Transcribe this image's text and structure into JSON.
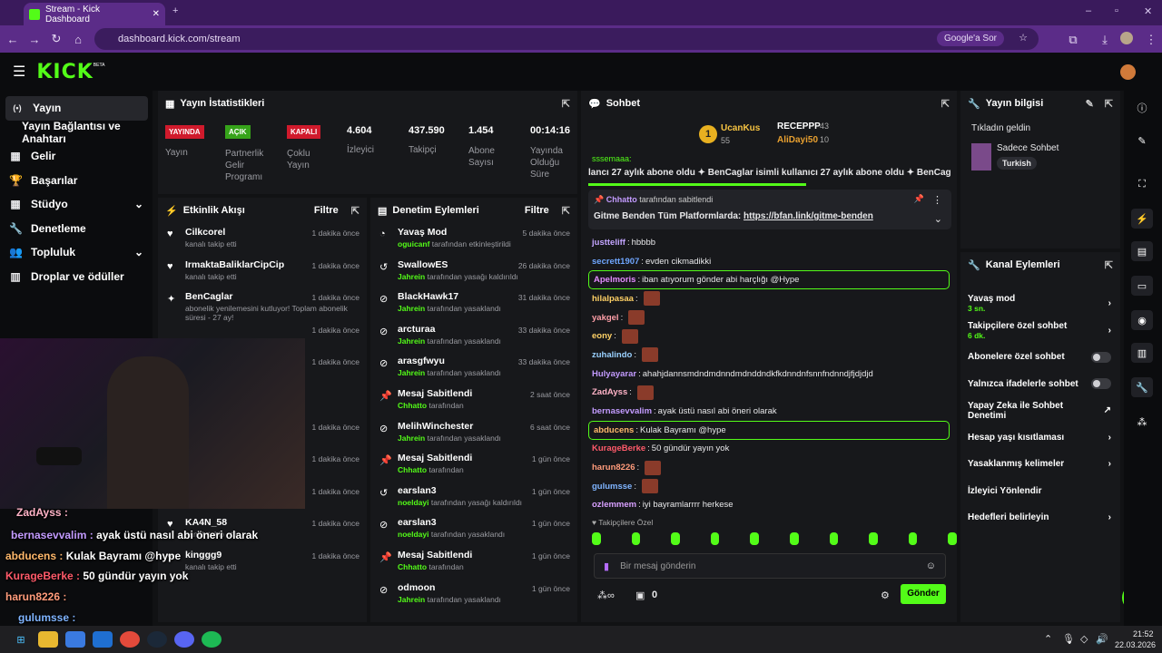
{
  "browser": {
    "tab_title": "Stream - Kick Dashboard",
    "url": "dashboard.kick.com/stream",
    "google_btn": "Google'a Sor"
  },
  "app": {
    "logo": "KICK",
    "beta": "BETA"
  },
  "nav": [
    {
      "label": "Yayın",
      "icon": "(•)"
    },
    {
      "label": "Yayın Bağlantısı ve Anahtarı",
      "icon": ""
    },
    {
      "label": "Gelir",
      "icon": "▦"
    },
    {
      "label": "Başarılar",
      "icon": "🏆"
    },
    {
      "label": "Stüdyo",
      "icon": "▦",
      "chevron": "⌄"
    },
    {
      "label": "Denetleme",
      "icon": "🔧"
    },
    {
      "label": "Topluluk",
      "icon": "👥",
      "chevron": "⌄"
    },
    {
      "label": "Droplar ve ödüller",
      "icon": "▥"
    }
  ],
  "stats": {
    "title": "Yayın İstatistikleri",
    "items": [
      {
        "value": "YAYINDA",
        "label": "Yayın",
        "badge": "red"
      },
      {
        "value": "AÇIK",
        "label": "Partnerlik Gelir Programı",
        "badge": "green"
      },
      {
        "value": "KAPALI",
        "label": "Çoklu Yayın",
        "badge": "red"
      },
      {
        "value": "4.604",
        "label": "İzleyici"
      },
      {
        "value": "437.590",
        "label": "Takipçi"
      },
      {
        "value": "1.454",
        "label": "Abone Sayısı"
      },
      {
        "value": "00:14:16",
        "label": "Yayında Olduğu Süre"
      }
    ]
  },
  "activity": {
    "title": "Etkinlik Akışı",
    "filter": "Filtre",
    "rows": [
      {
        "name": "Cilkcorel",
        "sub": "kanalı takip etti",
        "time": "1 dakika önce",
        "icon": "♥"
      },
      {
        "name": "IrmaktaBaliklarCipCip",
        "sub": "kanalı takip etti",
        "time": "1 dakika önce",
        "icon": "♥"
      },
      {
        "name": "BenCaglar",
        "sub": "abonelik yenilemesini kutluyor! Toplam abonelik süresi - 27 ay!",
        "time": "1 dakika önce",
        "icon": "✦"
      },
      {
        "name": "",
        "sub": "",
        "time": "1 dakika önce",
        "icon": ""
      },
      {
        "name": "",
        "sub": "lam abonelik",
        "time": "1 dakika önce",
        "icon": ""
      },
      {
        "name": "",
        "sub": "",
        "time": "",
        "icon": ""
      },
      {
        "name": "",
        "sub": "",
        "time": "1 dakika önce",
        "icon": ""
      },
      {
        "name": "",
        "sub": "",
        "time": "1 dakika önce",
        "icon": ""
      },
      {
        "name": "kinggg9",
        "sub": "",
        "time": "1 dakika önce",
        "icon": "♥"
      },
      {
        "name": "KA4N_58",
        "sub": "kanalı takip etti",
        "time": "1 dakika önce",
        "icon": "♥"
      },
      {
        "name": "kinggg9",
        "sub": "kanalı takip etti",
        "time": "1 dakika önce",
        "icon": "♥"
      }
    ]
  },
  "moderation": {
    "title": "Denetim Eylemleri",
    "filter": "Filtre",
    "rows": [
      {
        "name": "Yavaş Mod",
        "by": "oguicanf",
        "rest": "tarafından etkinleştirildi",
        "time": "5 dakika önce",
        "icon": "◔"
      },
      {
        "name": "SwallowES",
        "by": "Jahrein",
        "rest": "tarafından yasağı kaldırıldı",
        "time": "26 dakika önce",
        "icon": "↺"
      },
      {
        "name": "BlackHawk17",
        "by": "Jahrein",
        "rest": "tarafından yasaklandı",
        "time": "31 dakika önce",
        "icon": "⊘"
      },
      {
        "name": "arcturaa",
        "by": "Jahrein",
        "rest": "tarafından yasaklandı",
        "time": "33 dakika önce",
        "icon": "⊘"
      },
      {
        "name": "arasgfwyu",
        "by": "Jahrein",
        "rest": "tarafından yasaklandı",
        "time": "33 dakika önce",
        "icon": "⊘"
      },
      {
        "name": "Mesaj Sabitlendi",
        "by": "Chhatto",
        "rest": "tarafından",
        "time": "2 saat önce",
        "icon": "📌"
      },
      {
        "name": "MelihWinchester",
        "by": "Jahrein",
        "rest": "tarafından yasaklandı",
        "time": "6 saat önce",
        "icon": "⊘"
      },
      {
        "name": "Mesaj Sabitlendi",
        "by": "Chhatto",
        "rest": "tarafından",
        "time": "1 gün önce",
        "icon": "📌"
      },
      {
        "name": "earslan3",
        "by": "noeldayi",
        "rest": "tarafından yasağı kaldırıldı",
        "time": "1 gün önce",
        "icon": "↺"
      },
      {
        "name": "earslan3",
        "by": "noeldayi",
        "rest": "tarafından yasaklandı",
        "time": "1 gün önce",
        "icon": "⊘"
      },
      {
        "name": "Mesaj Sabitlendi",
        "by": "Chhatto",
        "rest": "tarafından",
        "time": "1 gün önce",
        "icon": "📌"
      },
      {
        "name": "odmoon",
        "by": "Jahrein",
        "rest": "tarafından yasaklandı",
        "time": "1 gün önce",
        "icon": "⊘"
      }
    ]
  },
  "chat": {
    "title": "Sohbet",
    "leaders": {
      "first": {
        "name": "UcanKus",
        "count": "55"
      },
      "second": {
        "name": "RECEPPP",
        "count": "43"
      },
      "third": {
        "name": "AliDayi50",
        "count": "10"
      }
    },
    "cut_top": "sssemaaa:",
    "marquee": "lancı 27 aylık abone oldu  ✦  BenCaglar isimli kullanıcı 27 aylık abone oldu  ✦  BenCag",
    "pinned": {
      "by": "Chhatto",
      "label": "tarafından sabitlendi",
      "text": "Gitme Benden Tüm Platformlarda: ",
      "link": "https://bfan.link/gitme-benden"
    },
    "lines": [
      {
        "user": "justteliff",
        "color": "#c3a5ff",
        "msg": "hbbbb",
        "hl": false,
        "emote": false
      },
      {
        "user": "secrett1907",
        "color": "#6fa6ff",
        "msg": "evden cikmadikki",
        "hl": false,
        "emote": false
      },
      {
        "user": "Apelmoris",
        "color": "#e48cff",
        "msg": "iban atıyorum gönder abi harçlığı @Hype",
        "hl": true,
        "emote": false
      },
      {
        "user": "hilalpasaa",
        "color": "#ffd166",
        "msg": "",
        "hl": false,
        "emote": true
      },
      {
        "user": "yakgel",
        "color": "#ff9fa8",
        "msg": "",
        "hl": false,
        "emote": true
      },
      {
        "user": "eony",
        "color": "#ffd166",
        "msg": "",
        "hl": false,
        "emote": true
      },
      {
        "user": "zuhalindo",
        "color": "#9ad1ff",
        "msg": "",
        "hl": false,
        "emote": true
      },
      {
        "user": "Hulyayarar",
        "color": "#c39bff",
        "msg": "ahahjdannsmdndmdnndmdnddndkfkdnndnfsnnfndnndjfjdjdjd",
        "hl": false,
        "emote": false
      },
      {
        "user": "ZadAyss",
        "color": "#ffb3c7",
        "msg": "",
        "hl": false,
        "emote": true
      },
      {
        "user": "bernasevvalim",
        "color": "#c39bff",
        "msg": "ayak üstü nasıl abi öneri olarak",
        "hl": false,
        "emote": false
      },
      {
        "user": "abducens",
        "color": "#ffb86b",
        "msg": "Kulak Bayramı @hype",
        "hl": true,
        "emote": false
      },
      {
        "user": "KurageBerke",
        "color": "#ff5a6a",
        "msg": "50 gündür yayın yok",
        "hl": false,
        "emote": false
      },
      {
        "user": "harun8226",
        "color": "#ff9b7b",
        "msg": "",
        "hl": false,
        "emote": true
      },
      {
        "user": "gulumsse",
        "color": "#7fb4ff",
        "msg": "",
        "hl": false,
        "emote": true
      },
      {
        "user": "ozlemmem",
        "color": "#d8a0ff",
        "msg": "iyi bayramlarrrr herkese",
        "hl": false,
        "emote": false
      }
    ],
    "followers_only": "Takipçilere Özel",
    "input_placeholder": "Bir mesaj gönderin",
    "points": "0",
    "send": "Gönder"
  },
  "stream_info": {
    "title": "Yayın bilgisi",
    "stream_title": "Tıkladın geldin",
    "category": "Sadece Sohbet",
    "tag": "Turkish"
  },
  "channel_actions": {
    "title": "Kanal Eylemleri",
    "items": [
      {
        "label": "Yavaş mod",
        "sub": "3 sn.",
        "kind": "chevron"
      },
      {
        "label": "Takipçilere özel sohbet",
        "sub": "6 dk.",
        "kind": "chevron"
      },
      {
        "label": "Abonelere özel sohbet",
        "sub": "",
        "kind": "toggle"
      },
      {
        "label": "Yalnızca ifadelerle sohbet",
        "sub": "",
        "kind": "toggle"
      },
      {
        "label": "Yapay Zeka ile Sohbet Denetimi",
        "sub": "",
        "kind": "external"
      },
      {
        "label": "Hesap yaşı kısıtlaması",
        "sub": "",
        "kind": "chevron"
      },
      {
        "label": "Yasaklanmış kelimeler",
        "sub": "",
        "kind": "chevron"
      },
      {
        "label": "İzleyici Yönlendir",
        "sub": "",
        "kind": "none"
      },
      {
        "label": "Hedefleri belirleyin",
        "sub": "",
        "kind": "chevron"
      }
    ]
  },
  "overlay": {
    "lines": [
      {
        "user": "ZadAyss :",
        "color": "#ffb3c7",
        "msg": ""
      },
      {
        "user": "bernasevvalim :",
        "color": "#c39bff",
        "msg": "ayak üstü nasıl abi öneri olarak"
      },
      {
        "user": "abducens :",
        "color": "#ffb86b",
        "msg": "Kulak Bayramı @hype"
      },
      {
        "user": "KurageBerke :",
        "color": "#ff5a6a",
        "msg": "50 gündür yayın yok"
      },
      {
        "user": "harun8226 :",
        "color": "#ff9b7b",
        "msg": ""
      },
      {
        "user": "gulumsse :",
        "color": "#7fb4ff",
        "msg": ""
      }
    ]
  },
  "taskbar": {
    "time": "21:52",
    "date": "22.03.2026"
  }
}
